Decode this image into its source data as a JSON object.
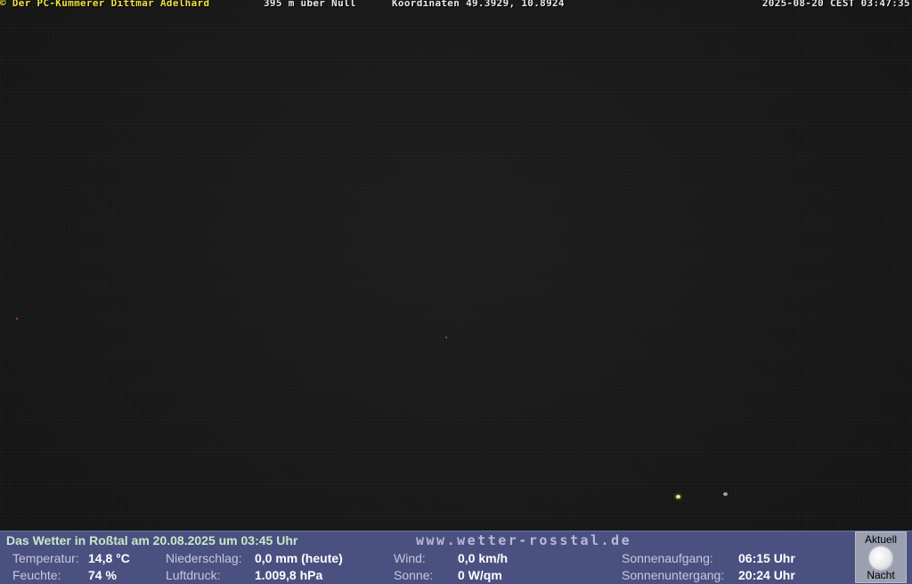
{
  "overlay": {
    "owner": "© Der PC-Kümmerer Dittmar Adelhard",
    "altitude": "395 m über Null",
    "coordinates": "Koordinaten 49.3929, 10.8924",
    "datetime": "2025-08-20 CEST 03:47:35"
  },
  "weather": {
    "headline": "Das Wetter in Roßtal am 20.08.2025 um 03:45 Uhr",
    "website": "www.wetter-rosstal.de",
    "temperature": {
      "label": "Temperatur:",
      "value": "14,8 °C"
    },
    "humidity": {
      "label": "Feuchte:",
      "value": "74 %"
    },
    "precipitation": {
      "label": "Niederschlag:",
      "value": "0,0 mm (heute)"
    },
    "pressure": {
      "label": "Luftdruck:",
      "value": "1.009,8 hPa"
    },
    "wind": {
      "label": "Wind:",
      "value": "0,0 km/h"
    },
    "sun": {
      "label": "Sonne:",
      "value": "0 W/qm"
    },
    "sunrise": {
      "label": "Sonnenaufgang:",
      "value": "06:15 Uhr"
    },
    "sunset": {
      "label": "Sonnenuntergang:",
      "value": "20:24 Uhr"
    },
    "moon": {
      "top_label": "Aktuell",
      "bottom_label": "Nacht",
      "icon": "moon-icon"
    }
  },
  "colors": {
    "overlay_owner": "#f0e040",
    "overlay_text": "#e8e8e8",
    "bar_background": "#4a5080",
    "headline": "#c8e8c8"
  }
}
